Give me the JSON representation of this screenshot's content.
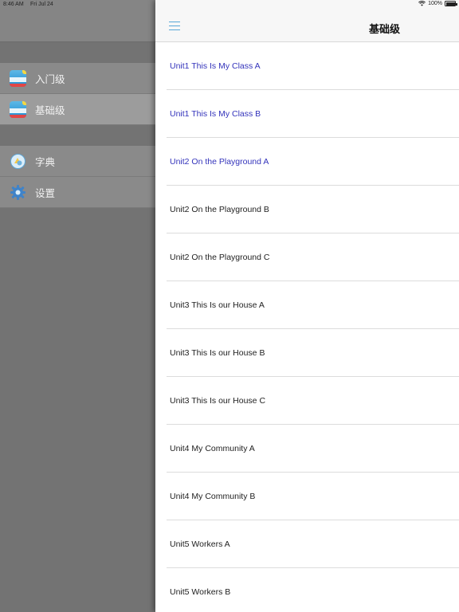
{
  "status_bar": {
    "time": "8:46 AM",
    "date": "Fri Jul 24",
    "battery": "100%",
    "battery_level": 1.0
  },
  "sidebar": {
    "groups": [
      {
        "items": [
          {
            "label": "入门级",
            "icon": "textbook-app-icon",
            "selected": false
          },
          {
            "label": "基础级",
            "icon": "textbook-app-icon",
            "selected": true
          }
        ]
      },
      {
        "items": [
          {
            "label": "字典",
            "icon": "dictionary-icon",
            "selected": false
          },
          {
            "label": "设置",
            "icon": "gear-icon",
            "selected": false
          }
        ]
      }
    ]
  },
  "detail": {
    "title": "基础级",
    "menu_icon": "hamburger-menu-icon",
    "lessons": [
      {
        "label": "Unit1 This Is My Class A",
        "visited": true
      },
      {
        "label": "Unit1 This Is My Class B",
        "visited": true
      },
      {
        "label": "Unit2 On the Playground A",
        "visited": true
      },
      {
        "label": "Unit2 On the Playground B",
        "visited": false
      },
      {
        "label": "Unit2 On the Playground C",
        "visited": false
      },
      {
        "label": "Unit3 This Is our House A",
        "visited": false
      },
      {
        "label": "Unit3 This Is our House B",
        "visited": false
      },
      {
        "label": "Unit3 This Is our House C",
        "visited": false
      },
      {
        "label": "Unit4 My Community A",
        "visited": false
      },
      {
        "label": "Unit4 My Community B",
        "visited": false
      },
      {
        "label": "Unit5 Workers A",
        "visited": false
      },
      {
        "label": "Unit5 Workers B",
        "visited": false
      }
    ]
  },
  "colors": {
    "visited_link": "#3333bb",
    "accent": "#5aa8d8"
  }
}
